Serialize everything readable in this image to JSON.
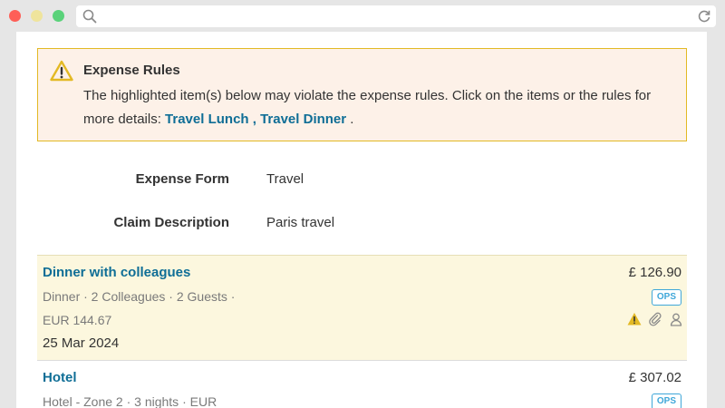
{
  "browser": {
    "search_icon": "search-icon",
    "reload_icon": "reload-icon"
  },
  "alert": {
    "title": "Expense Rules",
    "message": "The highlighted item(s) below may violate the expense rules. Click on the items or the rules for more details: ",
    "rule_link": "Travel Lunch , Travel Dinner",
    "trailing": " .",
    "icon": "warning-icon",
    "border_color": "#e3b924",
    "background_color": "#fdf1e8"
  },
  "fields": {
    "expense_form_label": "Expense Form",
    "expense_form_value": "Travel",
    "claim_description_label": "Claim Description",
    "claim_description_value": "Paris travel"
  },
  "items": [
    {
      "title": "Dinner with colleagues",
      "subtitle_line1": "Dinner · 2 Colleagues · 2 Guests ·",
      "subtitle_line2": "EUR 144.67",
      "date": "25 Mar 2024",
      "amount": "£ 126.90",
      "badge": "OPS",
      "highlighted": true,
      "icons": [
        "warning-icon",
        "paperclip-icon",
        "person-icon"
      ]
    },
    {
      "title": "Hotel",
      "subtitle_line1": "Hotel - Zone 2 · 3 nights · EUR",
      "amount": "£ 307.02",
      "badge": "OPS",
      "highlighted": false
    }
  ],
  "colors": {
    "link": "#0f6e96",
    "highlight_row": "#fcf7de",
    "badge": "#3fa7d9",
    "warning": "#e3b924"
  }
}
